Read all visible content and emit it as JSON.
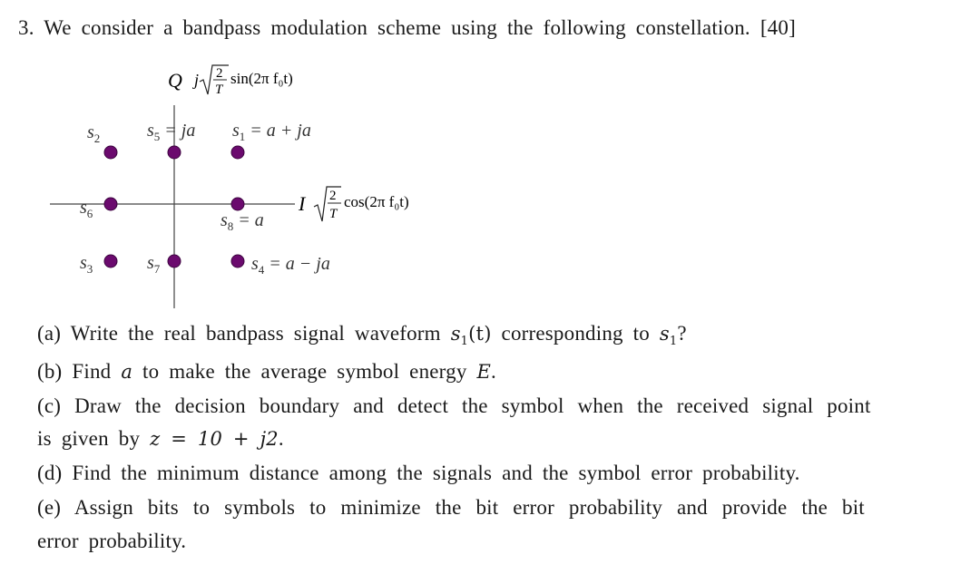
{
  "question": {
    "number": "3.",
    "intro": "We consider a bandpass modulation scheme using the following constellation.",
    "points": "[40]"
  },
  "constellation": {
    "q_axis": {
      "letter": "Q",
      "basis_prefix": "j",
      "basis_fraction_num": "2",
      "basis_fraction_den": "T",
      "basis_func": "sin(2π f₀t)"
    },
    "i_axis": {
      "letter": "I",
      "basis_fraction_num": "2",
      "basis_fraction_den": "T",
      "basis_func": "cos(2π f₀t)"
    },
    "symbols": [
      {
        "name": "s1",
        "base": "s",
        "sub": "1",
        "eq": "= a + ja",
        "i": 1,
        "q": 1
      },
      {
        "name": "s2",
        "base": "s",
        "sub": "2",
        "eq": "",
        "i": -1,
        "q": 1
      },
      {
        "name": "s3",
        "base": "s",
        "sub": "3",
        "eq": "",
        "i": -1,
        "q": -1
      },
      {
        "name": "s4",
        "base": "s",
        "sub": "4",
        "eq": "= a − ja",
        "i": 1,
        "q": -1
      },
      {
        "name": "s5",
        "base": "s",
        "sub": "5",
        "eq": "= ja",
        "i": 0,
        "q": 1
      },
      {
        "name": "s6",
        "base": "s",
        "sub": "6",
        "eq": "",
        "i": -1,
        "q": 0
      },
      {
        "name": "s7",
        "base": "s",
        "sub": "7",
        "eq": "",
        "i": 0,
        "q": -1
      },
      {
        "name": "s8",
        "base": "s",
        "sub": "8",
        "eq": "= a",
        "i": 1,
        "q": 0
      }
    ],
    "dot_color": "#6b0a6e"
  },
  "parts": {
    "a": {
      "label": "(a)",
      "pre": "Write the real bandpass signal waveform",
      "math1": "s",
      "math1_sub": "1",
      "math1_arg": "(t)",
      "mid": "corresponding to",
      "math2": "s",
      "math2_sub": "1",
      "post": "?"
    },
    "b": {
      "label": "(b)",
      "pre": "Find",
      "math": "a",
      "post": "to make the average symbol energy",
      "math2": "E",
      "end": "."
    },
    "c": {
      "label": "(c)",
      "line1": "Draw the decision boundary and detect the symbol when the received signal point",
      "line2_pre": "is given by",
      "math": "z = 10 + j2",
      "end": "."
    },
    "d": {
      "label": "(d)",
      "text": "Find the minimum distance among the signals and the symbol error probability."
    },
    "e": {
      "label": "(e)",
      "line1": "Assign bits to symbols to minimize the bit error probability and provide the bit",
      "line2": "error probability."
    }
  }
}
